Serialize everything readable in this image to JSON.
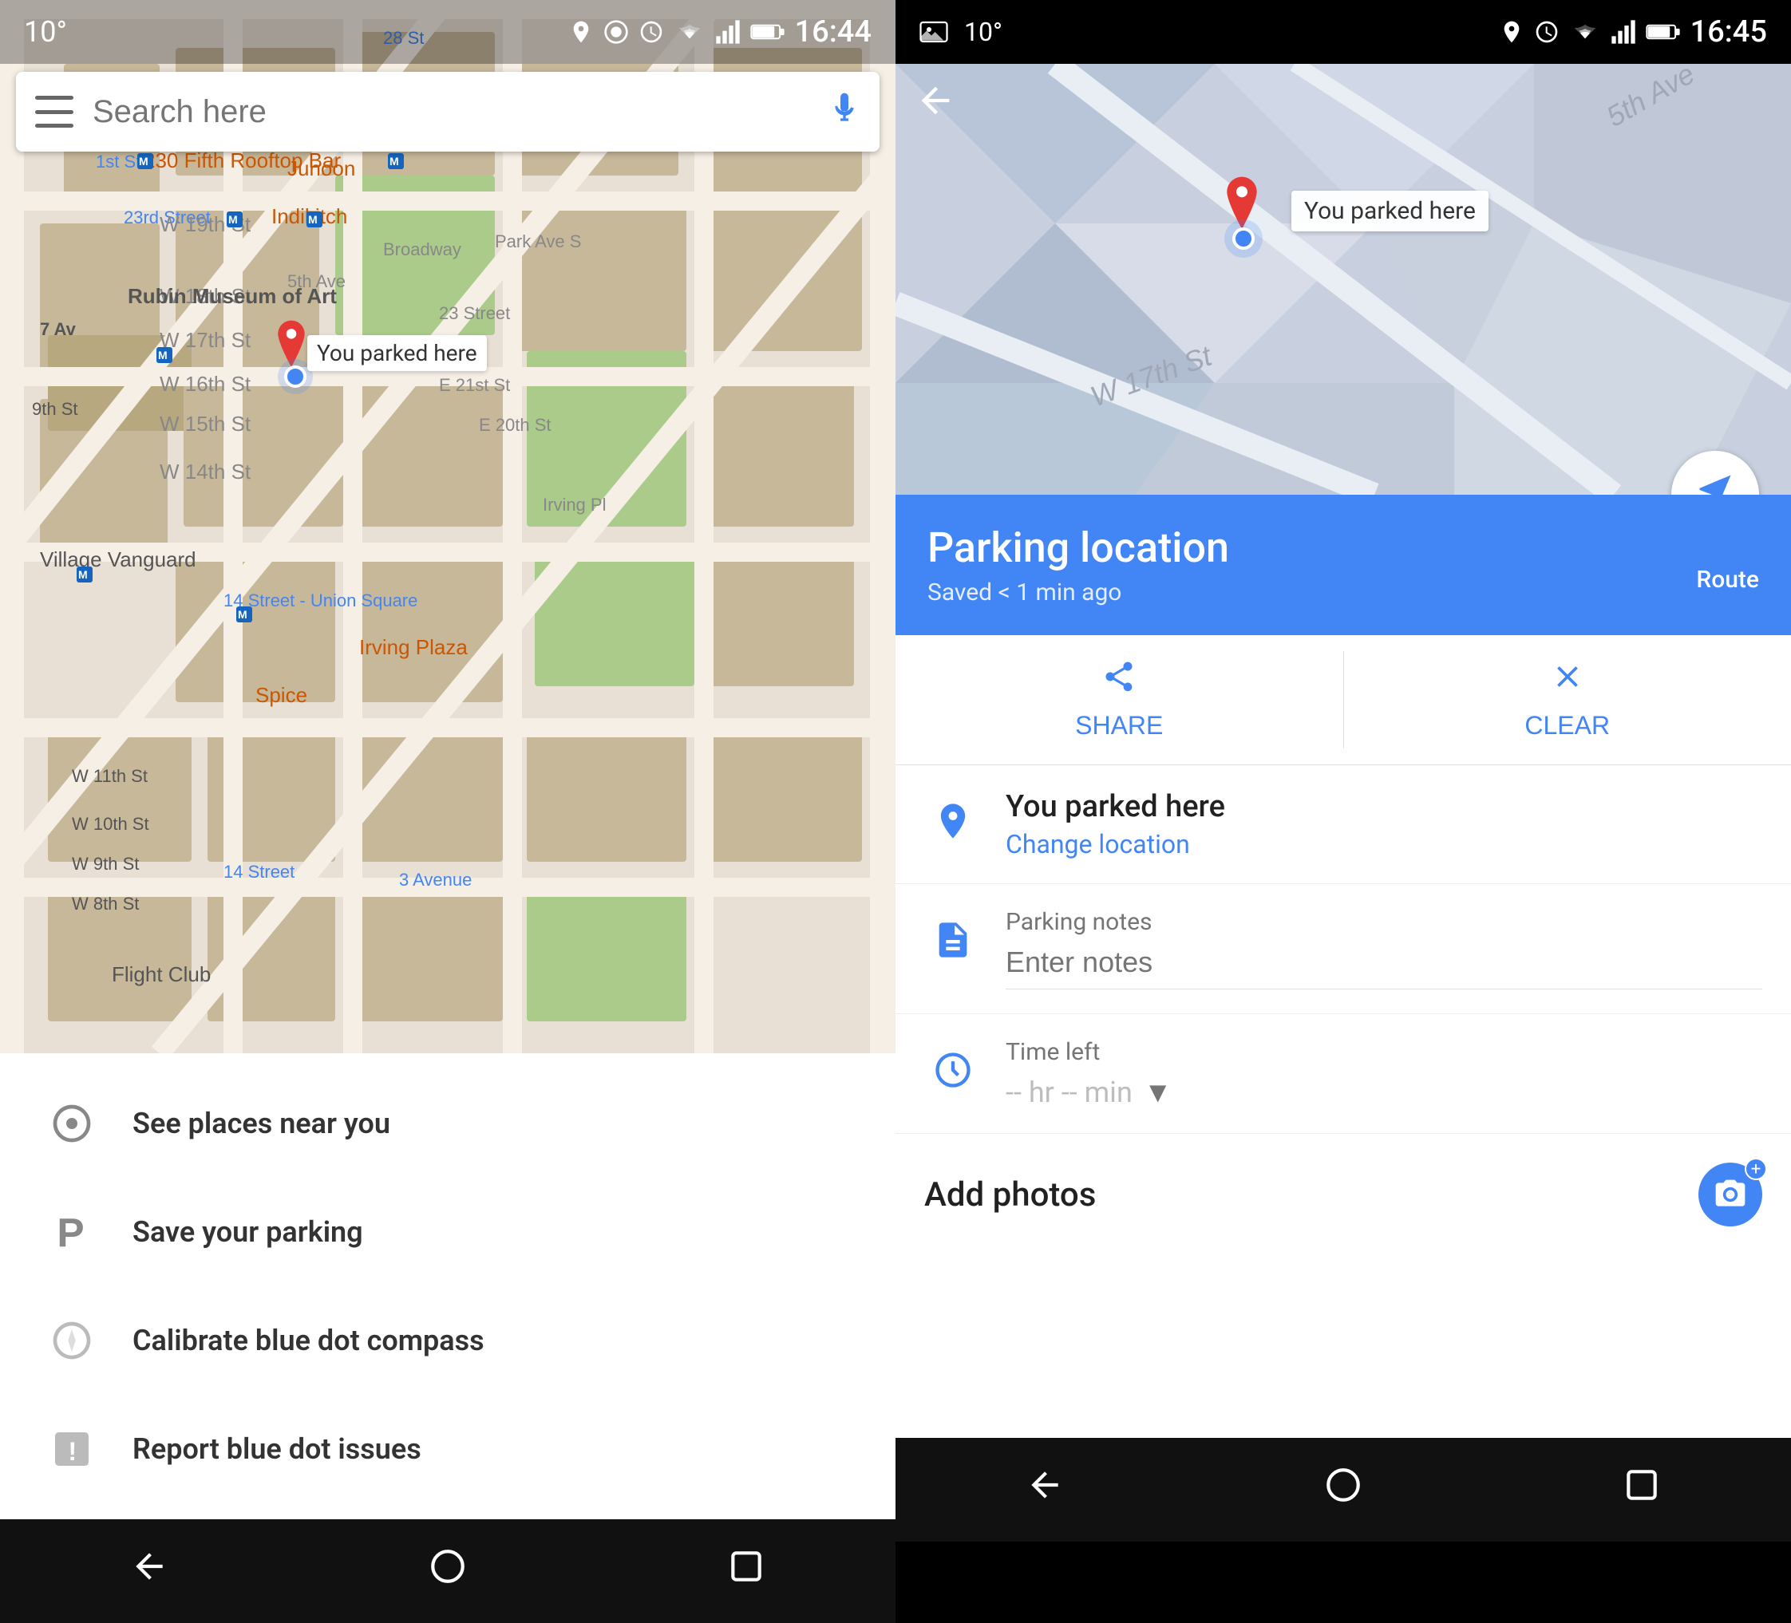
{
  "left": {
    "status": {
      "temp": "10°",
      "time": "16:44"
    },
    "search": {
      "placeholder": "Search here"
    },
    "map": {
      "park_label": "You parked here"
    },
    "menu": {
      "items": [
        {
          "id": "places",
          "label": "See places near you"
        },
        {
          "id": "parking",
          "label": "Save your parking"
        },
        {
          "id": "compass",
          "label": "Calibrate blue dot compass"
        },
        {
          "id": "report",
          "label": "Report blue dot issues"
        }
      ]
    }
  },
  "right": {
    "status": {
      "temp": "10°",
      "time": "16:45"
    },
    "header": {
      "title": "Parking location",
      "subtitle": "Saved < 1 min ago",
      "route_label": "Route"
    },
    "actions": {
      "share": "SHARE",
      "clear": "CLEAR"
    },
    "location": {
      "title": "You parked here",
      "change_link": "Change location"
    },
    "notes": {
      "label": "Parking notes",
      "placeholder": "Enter notes"
    },
    "time": {
      "label": "Time left",
      "value": "-- hr -- min"
    },
    "photos": {
      "label": "Add photos"
    },
    "map": {
      "park_label": "You parked here"
    }
  }
}
